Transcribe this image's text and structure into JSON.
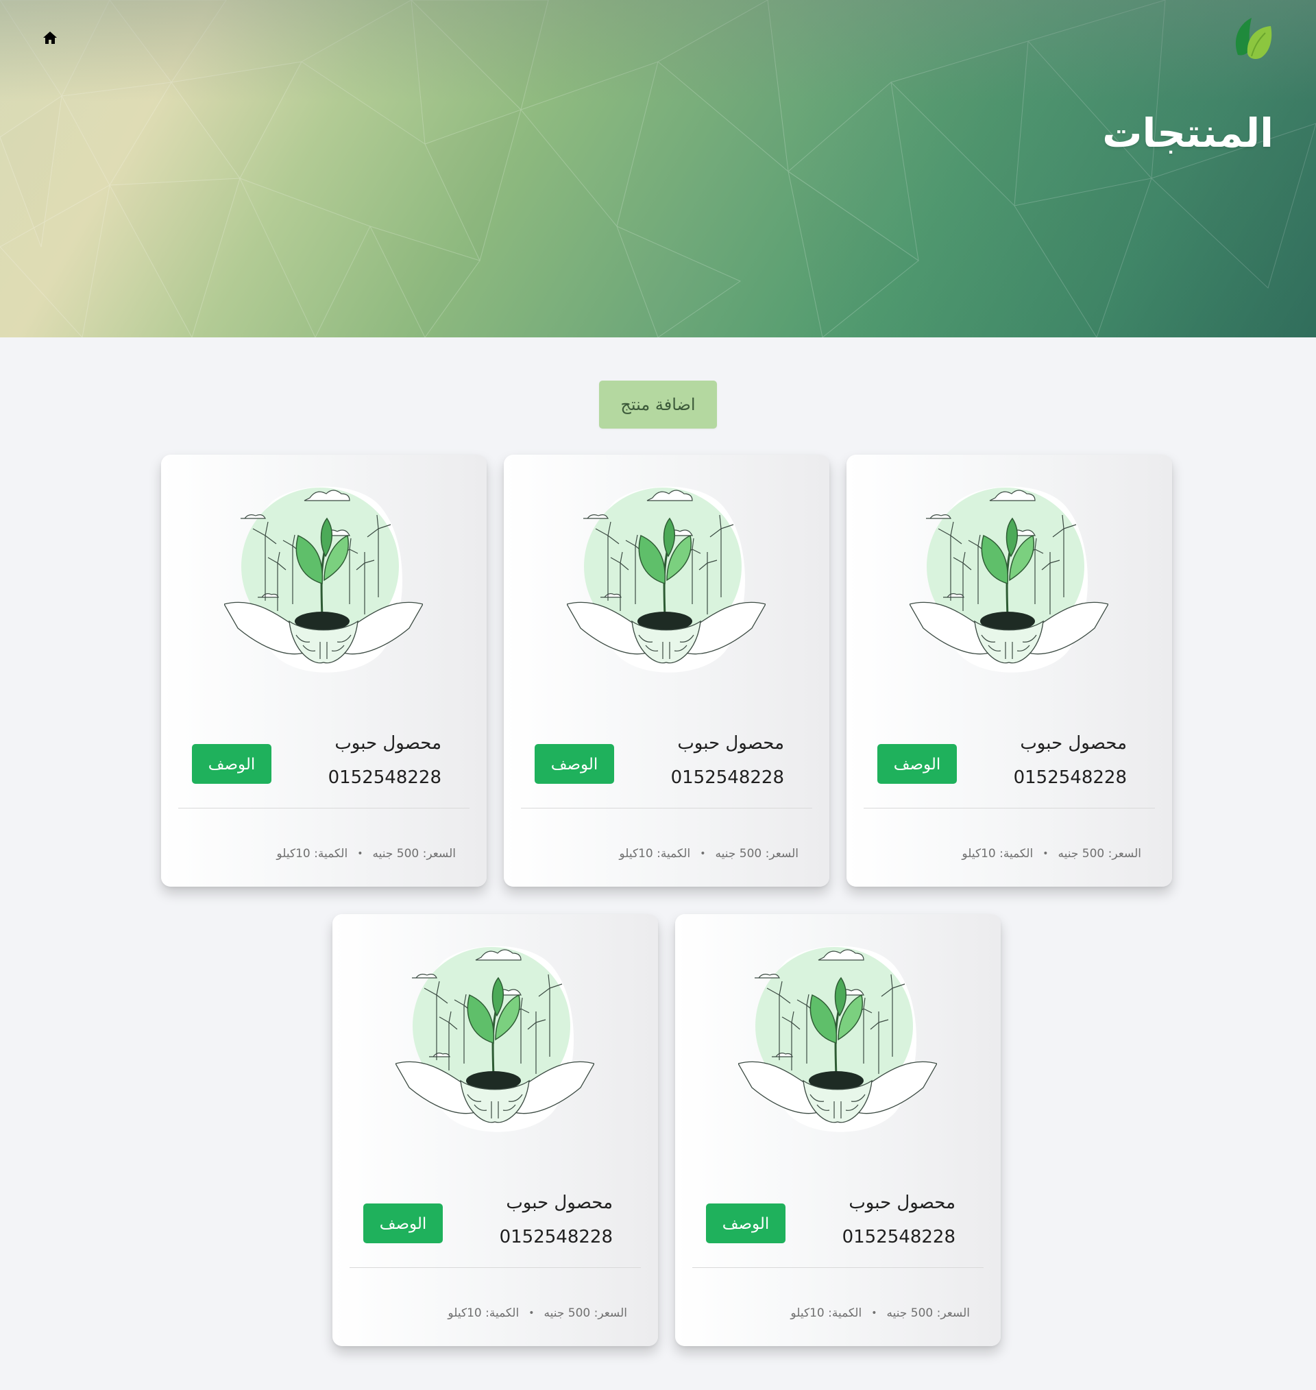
{
  "page": {
    "title": "المنتجات",
    "add_button_label": "اضافة منتج"
  },
  "header": {
    "home_icon": "home-icon",
    "logo_icon": "leaf-logo-icon"
  },
  "colors": {
    "primary_green": "#1fb15c",
    "add_button_bg": "#b4d8a0",
    "page_bg": "#f3f4f7"
  },
  "products": [
    {
      "name": "محصول حبوب",
      "phone": "0152548228",
      "description_button": "الوصف",
      "price": "السعر: 500 جنيه",
      "quantity": "الكمية: 10كيلو",
      "image_icon": "plant-in-hands-illustration"
    },
    {
      "name": "محصول حبوب",
      "phone": "0152548228",
      "description_button": "الوصف",
      "price": "السعر: 500 جنيه",
      "quantity": "الكمية: 10كيلو",
      "image_icon": "plant-in-hands-illustration"
    },
    {
      "name": "محصول حبوب",
      "phone": "0152548228",
      "description_button": "الوصف",
      "price": "السعر: 500 جنيه",
      "quantity": "الكمية: 10كيلو",
      "image_icon": "plant-in-hands-illustration"
    },
    {
      "name": "محصول حبوب",
      "phone": "0152548228",
      "description_button": "الوصف",
      "price": "السعر: 500 جنيه",
      "quantity": "الكمية: 10كيلو",
      "image_icon": "plant-in-hands-illustration"
    },
    {
      "name": "محصول حبوب",
      "phone": "0152548228",
      "description_button": "الوصف",
      "price": "السعر: 500 جنيه",
      "quantity": "الكمية: 10كيلو",
      "image_icon": "plant-in-hands-illustration"
    }
  ]
}
